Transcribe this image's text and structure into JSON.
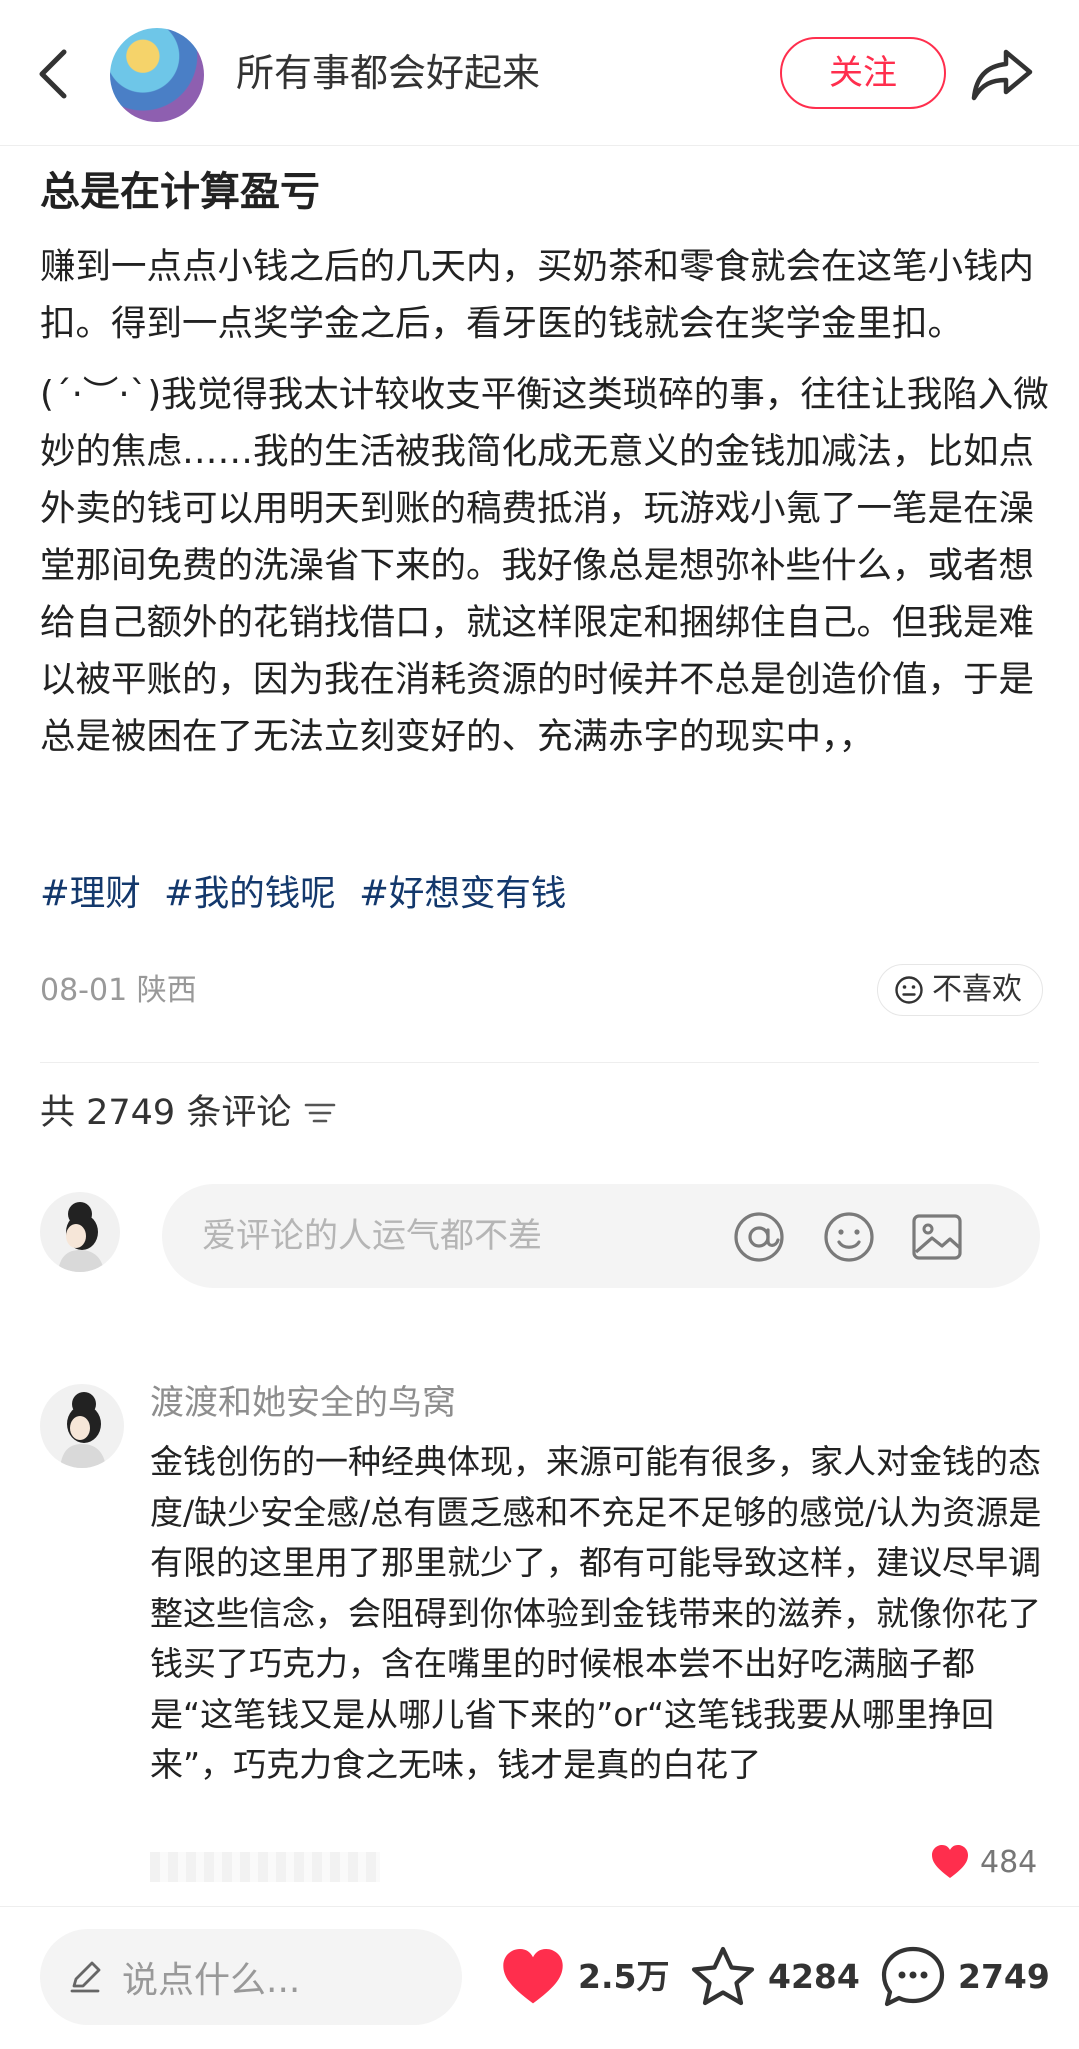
{
  "header": {
    "author_name": "所有事都会好起来",
    "follow_label": "关注"
  },
  "post": {
    "title": "总是在计算盈亏",
    "paragraph_1": "赚到一点点小钱之后的几天内，买奶茶和零食就会在这笔小钱内扣。得到一点奖学金之后，看牙医的钱就会在奖学金里扣。",
    "paragraph_2": "(ˊ·︶·ˋ)我觉得我太计较收支平衡这类琐碎的事，往往让我陷入微妙的焦虑……我的生活被我简化成无意义的金钱加减法，比如点外卖的钱可以用明天到账的稿费抵消，玩游戏小氪了一笔是在澡堂那间免费的洗澡省下来的。我好像总是想弥补些什么，或者想给自己额外的花销找借口，就这样限定和捆绑住自己。但我是难以被平账的，因为我在消耗资源的时候并不总是创造价值，于是总是被困在了无法立刻变好的、充满赤字的现实中，，",
    "tags": [
      "#理财",
      "#我的钱呢",
      "#好想变有钱"
    ],
    "date": "08-01",
    "location": "陕西",
    "dislike_label": "不喜欢"
  },
  "comments": {
    "count_label": "共 2749 条评论",
    "input_placeholder": "爱评论的人运气都不差",
    "items": [
      {
        "author": "渡渡和她安全的鸟窝",
        "text": "金钱创伤的一种经典体现，来源可能有很多，家人对金钱的态度/缺少安全感/总有匮乏感和不充足不足够的感觉/认为资源是有限的这里用了那里就少了，都有可能导致这样，建议尽早调整这些信念，会阻碍到你体验到金钱带来的滋养，就像你花了钱买了巧克力，含在嘴里的时候根本尝不出好吃满脑子都是“这笔钱又是从哪儿省下来的”or“这笔钱我要从哪里挣回来”，巧克力食之无味，钱才是真的白花了",
        "likes": "484"
      }
    ]
  },
  "bottom_bar": {
    "say_placeholder": "说点什么...",
    "likes": "2.5万",
    "collects": "4284",
    "comments": "2749"
  },
  "icons": {
    "back": "chevron-left-icon",
    "share": "share-arrow-icon",
    "dislike": "neutral-face-icon",
    "sort": "sort-lines-icon",
    "mention": "at-icon",
    "emoji": "smile-icon",
    "image": "image-icon",
    "edit": "pencil-icon",
    "like": "heart-icon",
    "collect": "star-icon",
    "comment": "chat-bubble-icon"
  },
  "colors": {
    "accent": "#ff2e4d",
    "tag": "#13386c",
    "muted": "#999999"
  }
}
